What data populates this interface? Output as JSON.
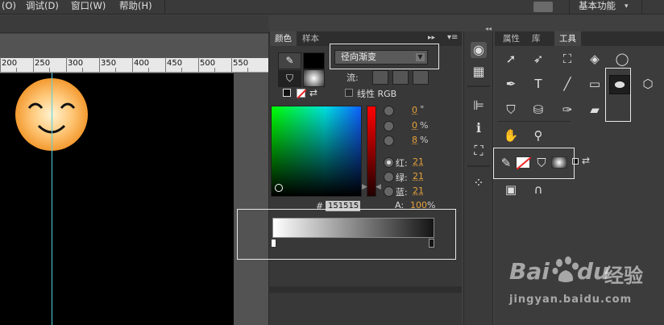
{
  "menu": {
    "items": [
      "(O)",
      "调试(D)",
      "窗口(W)",
      "帮助(H)"
    ],
    "workspace": "基本功能"
  },
  "ruler": {
    "ticks": [
      "200",
      "250",
      "300",
      "350",
      "400",
      "450",
      "500",
      "550"
    ]
  },
  "color_panel": {
    "tabs": [
      "颜色",
      "样本"
    ],
    "fill_type": "径向渐变",
    "flow_label": "流:",
    "linear_rgb_label": "线性 RGB",
    "hsb": [
      {
        "value": "0",
        "unit": "°"
      },
      {
        "value": "0",
        "unit": "%"
      },
      {
        "value": "8",
        "unit": "%"
      }
    ],
    "rgb": [
      {
        "label": "红:",
        "value": "21"
      },
      {
        "label": "绿:",
        "value": "21"
      },
      {
        "label": "蓝:",
        "value": "21"
      }
    ],
    "hex_prefix": "#",
    "hex_value": "151515",
    "alpha_label": "A:",
    "alpha_value": "100",
    "alpha_unit": "%",
    "gradient_start": "#ffffff",
    "gradient_end": "#151515"
  },
  "tools_panel": {
    "tabs": [
      "属性",
      "库",
      "工具"
    ],
    "text_tool_glyph": "T"
  },
  "watermark": {
    "brand_a": "Bai",
    "brand_b": "du",
    "brand_cn": "经验",
    "url": "jingyan.baidu.com"
  },
  "colors": {
    "accent_orange": "#e6a23c",
    "guide": "#5ad0e0",
    "highlight": "#e8e8e8"
  }
}
